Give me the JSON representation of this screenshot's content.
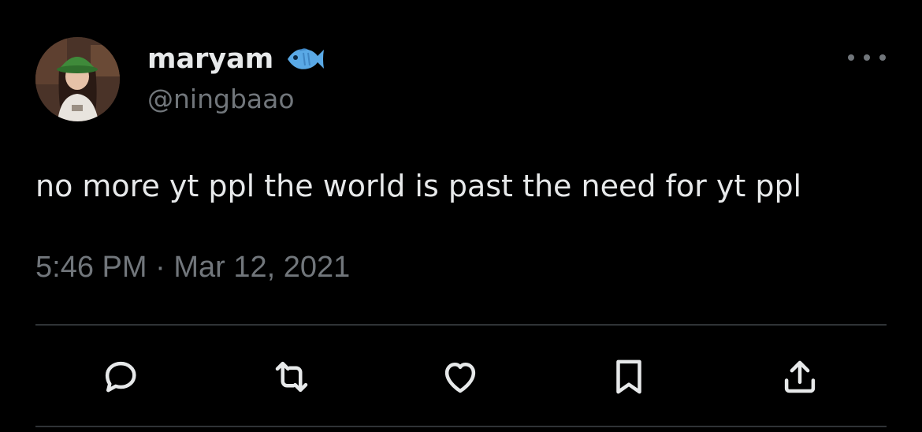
{
  "tweet": {
    "author": {
      "display_name": "maryam",
      "handle": "@ningbaao",
      "badge_icon": "fish-emoji-icon"
    },
    "text": "no more yt ppl the world is past the need for yt ppl",
    "time": "5:46 PM",
    "separator": "·",
    "date": "Mar 12, 2021"
  },
  "actions": [
    {
      "name": "reply",
      "icon": "reply-icon"
    },
    {
      "name": "retweet",
      "icon": "retweet-icon"
    },
    {
      "name": "like",
      "icon": "heart-icon"
    },
    {
      "name": "bookmark",
      "icon": "bookmark-icon"
    },
    {
      "name": "share",
      "icon": "share-icon"
    }
  ],
  "colors": {
    "background": "#000000",
    "primary_text": "#e7e9ea",
    "secondary_text": "#71767b",
    "divider": "#2f3336",
    "fish": "#5aa9e6"
  }
}
